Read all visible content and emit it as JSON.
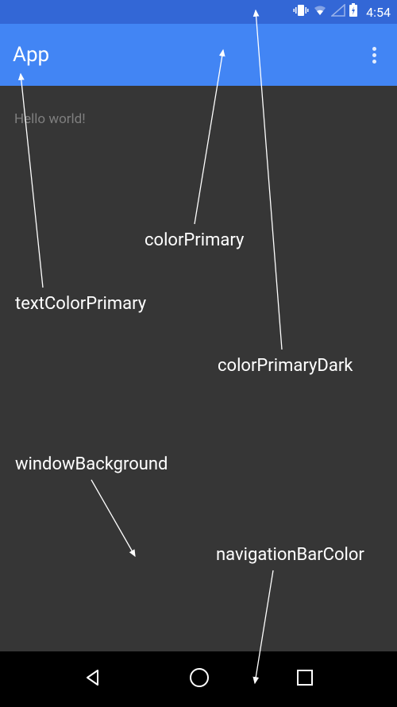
{
  "statusBar": {
    "time": "4:54"
  },
  "appBar": {
    "title": "App"
  },
  "content": {
    "helloText": "Hello world!"
  },
  "annotations": {
    "colorPrimary": "colorPrimary",
    "textColorPrimary": "textColorPrimary",
    "colorPrimaryDark": "colorPrimaryDark",
    "windowBackground": "windowBackground",
    "navigationBarColor": "navigationBarColor"
  },
  "colors": {
    "colorPrimaryDark": "#3367d6",
    "colorPrimary": "#4285f4",
    "windowBackground": "#363636",
    "navigationBarColor": "#000000",
    "textColorPrimary": "#ffffff",
    "bodyText": "#7f7f7f"
  }
}
